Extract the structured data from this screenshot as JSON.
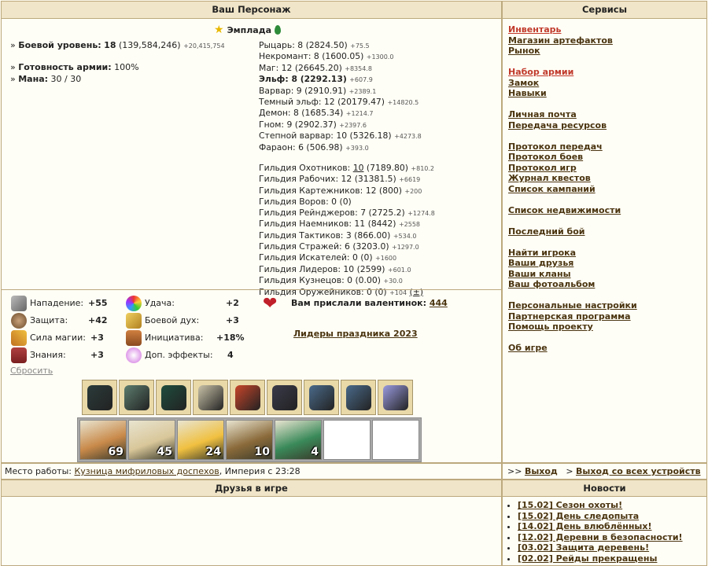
{
  "headers": {
    "character": "Ваш Персонаж",
    "services": "Сервисы",
    "friends": "Друзья в игре",
    "news": "Новости"
  },
  "hero": {
    "name": "Эмплада"
  },
  "stats": {
    "combat_label": "Боевой уровень:",
    "combat_level": "18",
    "combat_exp": "(139,584,246)",
    "combat_gain": "+20,415,754",
    "army_label": "Готовность армии:",
    "army_value": "100%",
    "mana_label": "Мана:",
    "mana_value": "30 / 30"
  },
  "factions": [
    {
      "text": "Рыцарь: 8 (2824.50)",
      "gain": "+75.5",
      "bold": false
    },
    {
      "text": "Некромант: 8 (1600.05)",
      "gain": "+1300.0",
      "bold": false
    },
    {
      "text": "Маг: 12 (26645.20)",
      "gain": "+8354.8",
      "bold": false
    },
    {
      "text": "Эльф: 8 (2292.13)",
      "gain": "+607.9",
      "bold": true
    },
    {
      "text": "Варвар: 9 (2910.91)",
      "gain": "+2389.1",
      "bold": false
    },
    {
      "text": "Темный эльф: 12 (20179.47)",
      "gain": "+14820.5",
      "bold": false
    },
    {
      "text": "Демон: 8 (1685.34)",
      "gain": "+1214.7",
      "bold": false
    },
    {
      "text": "Гном: 9 (2902.37)",
      "gain": "+2397.6",
      "bold": false
    },
    {
      "text": "Степной варвар: 10 (5326.18)",
      "gain": "+4273.8",
      "bold": false
    },
    {
      "text": "Фараон: 6 (506.98)",
      "gain": "+393.0",
      "bold": false
    }
  ],
  "guilds": [
    {
      "text": "Гильдия Охотников: ",
      "link": "10",
      "rest": " (7189.80)",
      "gain": "+810.2"
    },
    {
      "text": "Гильдия Рабочих: 12 (31381.5)",
      "link": "",
      "rest": "",
      "gain": "+6619"
    },
    {
      "text": "Гильдия Картежников: 12 (800)",
      "link": "",
      "rest": "",
      "gain": "+200"
    },
    {
      "text": "Гильдия Воров: 0 (0)",
      "link": "",
      "rest": "",
      "gain": ""
    },
    {
      "text": "Гильдия Рейнджеров: 7 (2725.2)",
      "link": "",
      "rest": "",
      "gain": "+1274.8"
    },
    {
      "text": "Гильдия Наемников: 11 (8442)",
      "link": "",
      "rest": "",
      "gain": "+2558"
    },
    {
      "text": "Гильдия Тактиков: 3 (866.00)",
      "link": "",
      "rest": "",
      "gain": "+534.0"
    },
    {
      "text": "Гильдия Стражей: 6 (3203.0)",
      "link": "",
      "rest": "",
      "gain": "+1297.0"
    },
    {
      "text": "Гильдия Искателей: 0 (0)",
      "link": "",
      "rest": "",
      "gain": "+1600"
    },
    {
      "text": "Гильдия Лидеров: 10 (2599)",
      "link": "",
      "rest": "",
      "gain": "+601.0"
    },
    {
      "text": "Гильдия Кузнецов: 0 (0.00)",
      "link": "",
      "rest": "",
      "gain": "+30.0"
    },
    {
      "text": "Гильдия Оружейников: 0 (0)",
      "link": "",
      "rest": "",
      "gain": "+104"
    }
  ],
  "guild_plus": "(±)",
  "attributes": {
    "attack_label": "Нападение:",
    "attack": "+55",
    "defense_label": "Защита:",
    "defense": "+42",
    "spell_label": "Сила магии:",
    "spell": "+3",
    "knowledge_label": "Знания:",
    "knowledge": "+3",
    "luck_label": "Удача:",
    "luck": "+2",
    "morale_label": "Боевой дух:",
    "morale": "+3",
    "initiative_label": "Инициатива:",
    "initiative": "+18%",
    "effects_label": "Доп. эффекты:",
    "effects": "4",
    "reset": "Сбросить"
  },
  "valentine": {
    "text": "Вам прислали валентинок:",
    "count": "444",
    "leaders": "Лидеры праздника 2023"
  },
  "equipment_colors": [
    "#2b3b3a",
    "#5c7d6e",
    "#1f4d3e",
    "#c9c2a8",
    "#c8452a",
    "#3a3a4a",
    "#4a6a8a",
    "#4a6a8a",
    "#9a9ae0"
  ],
  "army": [
    {
      "count": "69",
      "color": "#c98a4a"
    },
    {
      "count": "45",
      "color": "#d9c79a"
    },
    {
      "count": "24",
      "color": "#f0c040"
    },
    {
      "count": "10",
      "color": "#8a6a3a"
    },
    {
      "count": "4",
      "color": "#3a8a5a"
    },
    {
      "count": "",
      "color": "#ffffff"
    },
    {
      "count": "",
      "color": "#ffffff"
    }
  ],
  "work": {
    "label": "Место работы:",
    "place": "Кузница мифриловых доспехов",
    "rest": ", Империя с 23:28"
  },
  "services": {
    "inventory": "Инвентарь",
    "artifact_shop": "Магазин артефактов",
    "market": "Рынок",
    "recruit": "Набор армии",
    "castle": "Замок",
    "skills": "Навыки",
    "mail": "Личная почта",
    "transfer": "Передача ресурсов",
    "log_transfers": "Протокол передач",
    "log_battles": "Протокол боев",
    "log_games": "Протокол игр",
    "quest_log": "Журнал квестов",
    "campaigns": "Список кампаний",
    "realty": "Список недвижимости",
    "last_battle": "Последний бой",
    "find_player": "Найти игрока",
    "friends": "Ваши друзья",
    "clans": "Ваши кланы",
    "photo": "Ваш фотоальбом",
    "settings": "Персональные настройки",
    "partner": "Партнерская программа",
    "help": "Помощь проекту",
    "about": "Об игре"
  },
  "logout": {
    "prefix1": ">>",
    "exit": "Выход",
    "prefix2": ">",
    "exit_all": "Выход со всех устройств"
  },
  "news": [
    "[15.02] Сезон охоты!",
    "[15.02] День следопыта",
    "[14.02] День влюблённых!",
    "[12.02] Деревни в безопасности!",
    "[03.02] Защита деревень!",
    "[02.02] Рейды прекращены"
  ]
}
